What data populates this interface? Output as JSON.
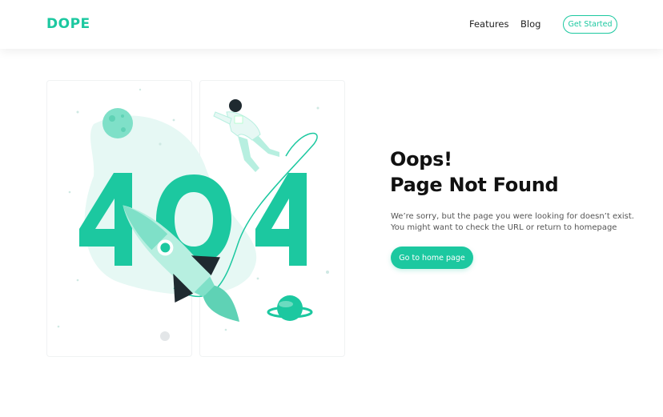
{
  "header": {
    "logo": "DOPE",
    "nav": {
      "features": "Features",
      "blog": "Blog"
    },
    "cta_label": "Get Started"
  },
  "illustration": {
    "big_text": "404",
    "icons": [
      "moon-icon",
      "astronaut-icon",
      "rocket-icon",
      "planet-icon"
    ]
  },
  "main": {
    "heading_line1": "Oops!",
    "heading_line2": "Page Not Found",
    "message_line1": "We’re sorry, but the page you were looking for doesn’t exist.",
    "message_line2": "You might want to check the URL or return to homepage",
    "button_label": "Go to home page"
  },
  "colors": {
    "accent": "#1cc8a0",
    "accent_light": "#7fe0c8",
    "accent_pale": "#e6f8f4",
    "dark": "#1f2a30"
  }
}
